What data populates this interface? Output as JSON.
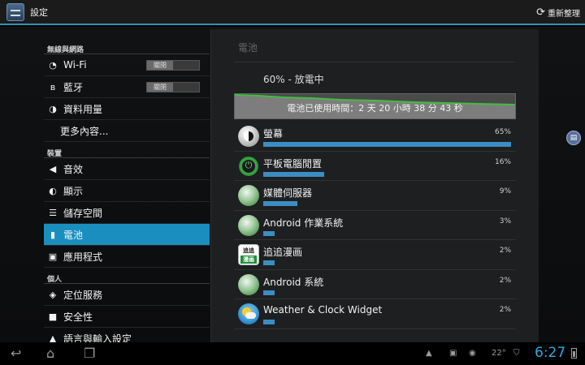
{
  "app": {
    "title": "設定",
    "refresh_label": "重新整理"
  },
  "sidebar": {
    "categories": [
      "無線與網路",
      "裝置",
      "個人"
    ],
    "items": [
      {
        "label": "Wi-Fi",
        "icon": "wifi-icon",
        "toggle": "關閉"
      },
      {
        "label": "藍牙",
        "icon": "bluetooth-icon",
        "toggle": "關閉"
      },
      {
        "label": "資料用量",
        "icon": "data-usage-icon"
      },
      {
        "label": "更多內容..."
      },
      {
        "label": "音效",
        "icon": "volume-icon"
      },
      {
        "label": "顯示",
        "icon": "display-icon"
      },
      {
        "label": "儲存空間",
        "icon": "storage-icon"
      },
      {
        "label": "電池",
        "icon": "battery-icon",
        "active": true
      },
      {
        "label": "應用程式",
        "icon": "apps-icon"
      },
      {
        "label": "定位服務",
        "icon": "location-icon"
      },
      {
        "label": "安全性",
        "icon": "lock-icon"
      },
      {
        "label": "語言與輸入設定",
        "icon": "language-icon"
      }
    ]
  },
  "battery": {
    "title": "電池",
    "status": "60% - 放電中",
    "graph_label": "電池已使用時間：2 天 20 小時 38 分 43 秒",
    "accent_color": "#3b8ec4",
    "entries": [
      {
        "name": "螢幕",
        "pct": "65%",
        "value": 65,
        "icon": "screen-icon"
      },
      {
        "name": "平板電腦閒置",
        "pct": "16%",
        "value": 16,
        "icon": "power-icon"
      },
      {
        "name": "媒體伺服器",
        "pct": "9%",
        "value": 9,
        "icon": "android-disc-icon"
      },
      {
        "name": "Android 作業系統",
        "pct": "3%",
        "value": 3,
        "icon": "android-disc-icon"
      },
      {
        "name": "追追漫画",
        "pct": "2%",
        "value": 2,
        "icon": "manga-app-icon"
      },
      {
        "name": "Android 系統",
        "pct": "2%",
        "value": 2,
        "icon": "android-disc-icon"
      },
      {
        "name": "Weather & Clock Widget",
        "pct": "2%",
        "value": 2,
        "icon": "weather-widget-icon"
      }
    ]
  },
  "statusbar": {
    "time": "6:27",
    "temperature": "22°"
  }
}
